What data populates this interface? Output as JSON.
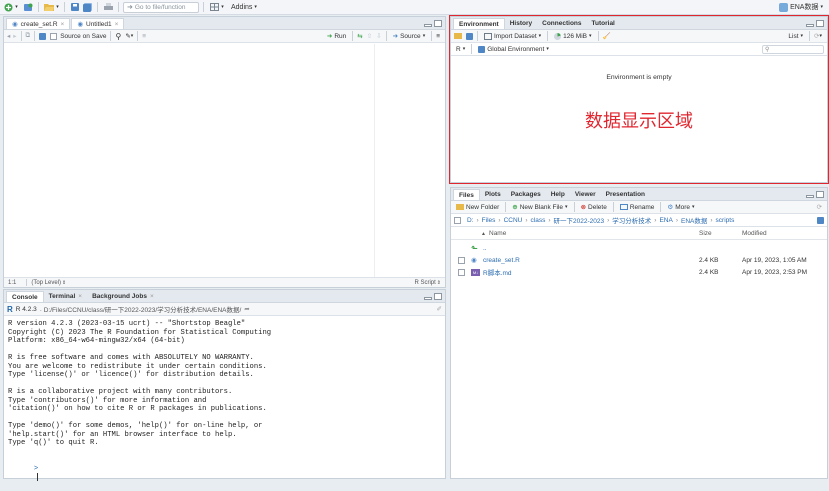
{
  "toolbar": {
    "goto_placeholder": "Go to file/function",
    "addins": "Addins",
    "project": "ENA数据"
  },
  "editor": {
    "tabs": [
      {
        "label": "create_set.R"
      },
      {
        "label": "Untitled1"
      }
    ],
    "source_on_save": "Source on Save",
    "run": "Run",
    "source": "Source",
    "status_position": "1:1",
    "status_level": "(Top Level)",
    "status_type": "R Script"
  },
  "console": {
    "tabs": [
      "Console",
      "Terminal",
      "Background Jobs"
    ],
    "r_version": "R 4.2.3",
    "path": "· D:/Files/CCNU/class/研一下2022-2023/学习分析技术/ENA/ENA数据/",
    "lines": [
      "R version 4.2.3 (2023-03-15 ucrt) -- \"Shortstop Beagle\"",
      "Copyright (C) 2023 The R Foundation for Statistical Computing",
      "Platform: x86_64-w64-mingw32/x64 (64-bit)",
      "",
      "R is free software and comes with ABSOLUTELY NO WARRANTY.",
      "You are welcome to redistribute it under certain conditions.",
      "Type 'license()' or 'licence()' for distribution details.",
      "",
      "R is a collaborative project with many contributors.",
      "Type 'contributors()' for more information and",
      "'citation()' on how to cite R or R packages in publications.",
      "",
      "Type 'demo()' for some demos, 'help()' for on-line help, or",
      "'help.start()' for an HTML browser interface to help.",
      "Type 'q()' to quit R.",
      ""
    ],
    "prompt": ">"
  },
  "environment": {
    "tabs": [
      "Environment",
      "History",
      "Connections",
      "Tutorial"
    ],
    "import_dataset": "Import Dataset",
    "memory": "126 MiB",
    "list_view": "List",
    "language": "R",
    "scope": "Global Environment",
    "empty_message": "Environment is empty",
    "annotation": "数据显示区域",
    "annotation_color": "#e0262f"
  },
  "files": {
    "tabs": [
      "Files",
      "Plots",
      "Packages",
      "Help",
      "Viewer",
      "Presentation"
    ],
    "new_folder": "New Folder",
    "new_blank_file": "New Blank File",
    "delete": "Delete",
    "rename": "Rename",
    "more": "More",
    "breadcrumb": [
      "D:",
      "Files",
      "CCNU",
      "class",
      "研一下2022-2023",
      "学习分析技术",
      "ENA",
      "ENA数据",
      "scripts"
    ],
    "columns": {
      "name": "Name",
      "size": "Size",
      "modified": "Modified"
    },
    "up_label": "..",
    "rows": [
      {
        "name": "create_set.R",
        "size": "2.4 KB",
        "modified": "Apr 19, 2023, 1:05 AM",
        "icon": "r-file-icon"
      },
      {
        "name": "R脚本.md",
        "size": "2.4 KB",
        "modified": "Apr 19, 2023, 2:53 PM",
        "icon": "markdown-file-icon"
      }
    ]
  }
}
